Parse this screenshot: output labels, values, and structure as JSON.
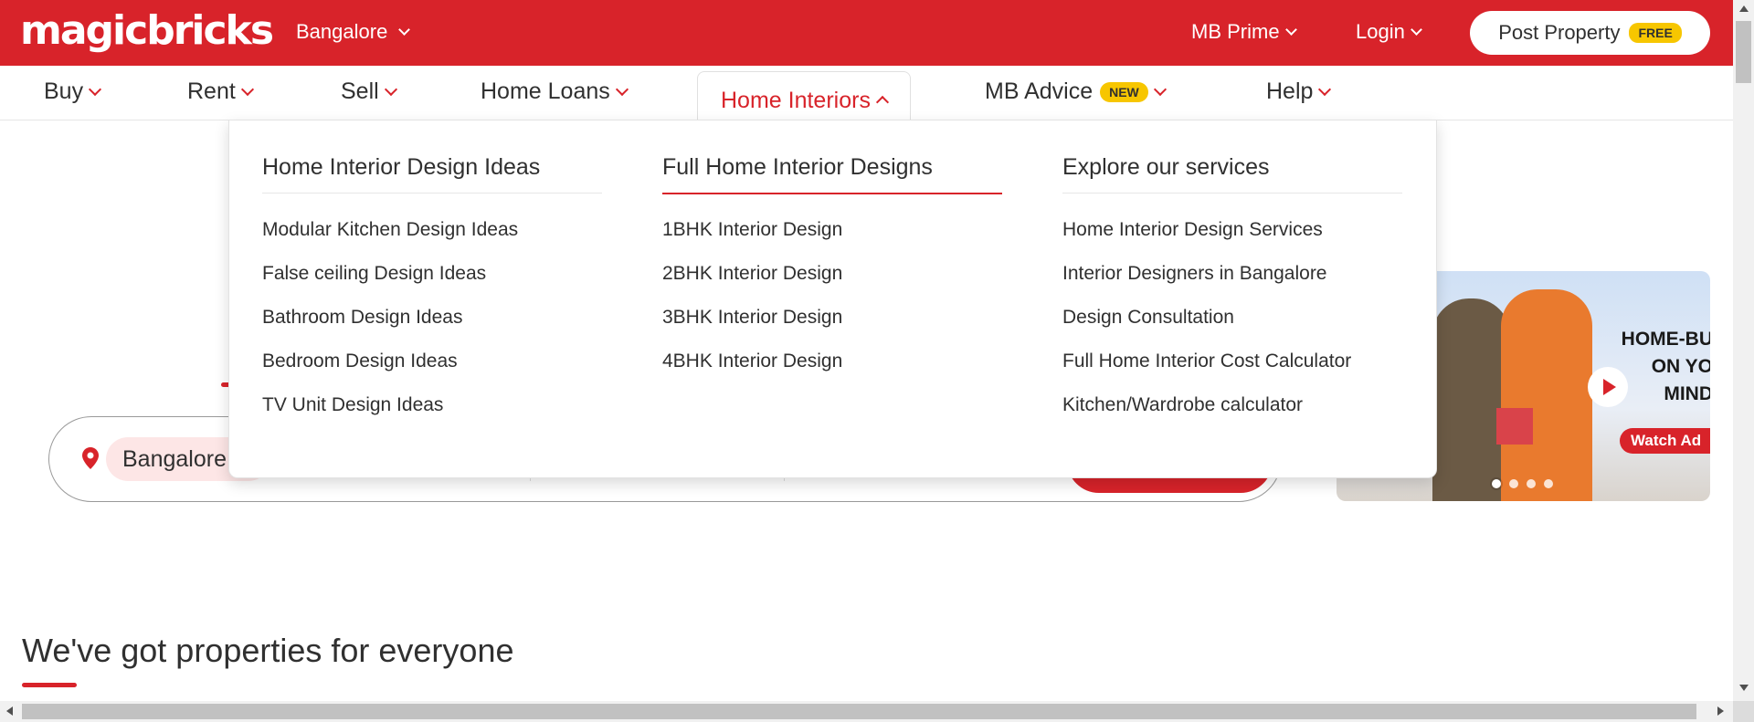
{
  "colors": {
    "brand": "#d8232a",
    "badge": "#f7c600"
  },
  "header": {
    "logo": "magicbricks",
    "city": "Bangalore",
    "mb_prime": "MB Prime",
    "login": "Login",
    "post_property": "Post Property",
    "post_badge": "FREE"
  },
  "nav": {
    "items": [
      {
        "label": "Buy"
      },
      {
        "label": "Rent"
      },
      {
        "label": "Sell"
      },
      {
        "label": "Home Loans"
      },
      {
        "label": "Home Interiors"
      },
      {
        "label": "MB Advice",
        "badge": "NEW"
      },
      {
        "label": "Help"
      }
    ],
    "active_index": 4
  },
  "dropdown": {
    "columns": [
      {
        "heading": "Home Interior Design Ideas",
        "links": [
          "Modular Kitchen Design Ideas",
          "False ceiling Design Ideas",
          "Bathroom Design Ideas",
          "Bedroom Design Ideas",
          "TV Unit Design Ideas"
        ]
      },
      {
        "heading": "Full Home Interior Designs",
        "links": [
          "1BHK Interior Design",
          "2BHK Interior Design",
          "3BHK Interior Design",
          "4BHK Interior Design"
        ]
      },
      {
        "heading": "Explore our services",
        "links": [
          "Home Interior Design Services",
          "Interior Designers in Bangalore",
          "Design Consultation",
          "Full Home Interior Cost Calculator",
          "Kitchen/Wardrobe calculator"
        ]
      }
    ],
    "active_column": 1
  },
  "search": {
    "city_chip": "Bangalore"
  },
  "banner": {
    "headline": "HOME-BU\nON YO\nMIND",
    "cta": "Watch Ad",
    "slides": 4,
    "active_slide": 0
  },
  "section": {
    "title": "We've got properties for everyone"
  }
}
